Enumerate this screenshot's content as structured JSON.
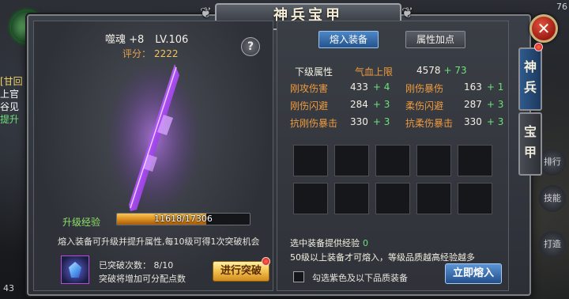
{
  "window": {
    "title": "神兵宝甲",
    "close_label": "✕"
  },
  "hud": {
    "left_lines": [
      {
        "text": "[甘回",
        "cls": "hl-yellow"
      },
      {
        "text": "上官",
        "cls": ""
      },
      {
        "text": "谷见",
        "cls": ""
      },
      {
        "text": "提升",
        "cls": "hl-green"
      }
    ],
    "percent": "43",
    "right_top": "76",
    "right_buttons": [
      "排行",
      "技能",
      "打造"
    ]
  },
  "item": {
    "name": "噬魂 +8",
    "level": "LV.106",
    "score_label": "评分：",
    "score_value": "2222",
    "help_label": "?"
  },
  "exp": {
    "label": "升级经验",
    "current": 11618,
    "max": 17306,
    "text": "11618/17306"
  },
  "info": {
    "smelt_desc": "熔入装备可升级并提升属性,每10级可得1次突破机会",
    "break_count": "已突破次数：  8/10",
    "break_desc": "突破将增加可分配点数",
    "break_button": "进行突破"
  },
  "tabs": {
    "smelt": "熔入装备",
    "attr_add": "属性加点"
  },
  "attrs": {
    "next_label": "下级属性",
    "hp_label": "气血上限",
    "hp_value": "4578",
    "hp_plus": "+ 73",
    "rows": [
      {
        "n1": "刚攻伤害",
        "v1": "433",
        "p1": "+ 4",
        "n2": "刚伤暴伤",
        "v2": "163",
        "p2": "+ 1"
      },
      {
        "n1": "刚伤闪避",
        "v1": "284",
        "p1": "+ 3",
        "n2": "柔伤闪避",
        "v2": "287",
        "p2": "+ 3"
      },
      {
        "n1": "抗刚伤暴击",
        "v1": "330",
        "p1": "+ 3",
        "n2": "抗柔伤暴击",
        "v2": "330",
        "p2": "+ 3"
      }
    ]
  },
  "bottom": {
    "provide_label": "选中装备提供经验",
    "provide_value": "0",
    "rule": "50级以上装备才可熔入，等级品质越高经验越多",
    "checkbox_label": "勾选紫色及以下品质装备",
    "smelt_button": "立即熔入"
  },
  "side_tabs": {
    "active": [
      "神",
      "兵"
    ],
    "inactive": [
      "宝",
      "甲"
    ]
  },
  "colors": {
    "accent_blue": "#2f5a8c",
    "gold": "#f4c553",
    "green_plus": "#6fe07a",
    "orange_label": "#ef9b3f",
    "purple_weapon": "#b455ff"
  }
}
